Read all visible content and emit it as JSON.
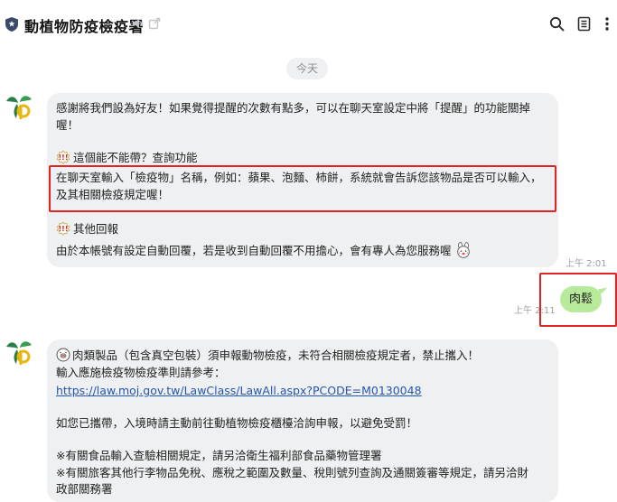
{
  "header": {
    "title": "動植物防疫檢疫署",
    "icons": [
      "shield-icon",
      "speaker-mute-icon",
      "external-link-icon",
      "search-icon",
      "notes-icon",
      "more-icon"
    ]
  },
  "date_separator": "今天",
  "messages": {
    "bot1": {
      "intro": "感謝將我們設為好友！如果覺得提醒的次數有點多，可以在聊天室設定中將「提醒」的功能關掉喔！",
      "intro_line1": "感謝將我們設為好友！如果覺得提醒的次數有點多，可以在聊天室設定中將「提醒」的功能關掉",
      "intro_line2": "喔！",
      "section1_title": "這個能不能帶？查詢功能",
      "section1_body_line1": "在聊天室輸入「檢疫物」名稱，例如：蘋果、泡麵、柿餅，系統就會告訴您該物品是否可以輸入，",
      "section1_body_line2": "及其相關檢疫規定喔！",
      "section2_title": "其他回報",
      "section2_body": "由於本帳號有設定自動回覆，若是收到自動回覆不用擔心，會有專人為您服務喔",
      "time": "上午 2:01"
    },
    "user": {
      "text": "肉鬆",
      "time": "上午 2:11"
    },
    "bot2": {
      "line1": "肉類製品（包含真空包裝）須申報動物檢疫，未符合相關檢疫規定者，禁止攜入！",
      "line2": "輸入應施檢疫物檢疫準則請參考：",
      "link": "https://law.moj.gov.tw/LawClass/LawAll.aspx?PCODE=M0130048",
      "line3": "如您已攜帶，入境時請主動前往動植物檢疫櫃檯洽詢申報，以避免受罰！",
      "line4": "※有關食品輸入查驗相關規定，請另洽衛生福利部食品藥物管理署",
      "line5": "※有關旅客其他行李物品免稅、應稅之範圍及數量、稅則號列查詢及通關簽審等規定，請另洽財",
      "line6": "政部關務署"
    }
  },
  "colors": {
    "incoming_bubble": "#eef0f1",
    "outgoing_bubble": "#b7eb9b",
    "highlight": "#e02424",
    "link": "#2456b3"
  }
}
